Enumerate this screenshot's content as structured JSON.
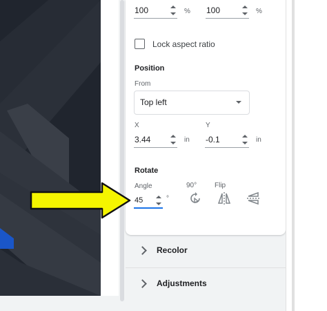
{
  "size": {
    "width": {
      "value": "100",
      "unit": "%"
    },
    "height": {
      "value": "100",
      "unit": "%"
    }
  },
  "lock_aspect_ratio": {
    "label": "Lock aspect ratio",
    "checked": false
  },
  "position": {
    "title": "Position",
    "from_label": "From",
    "from_value": "Top left",
    "x_label": "X",
    "x_value": "3.44",
    "x_unit": "in",
    "y_label": "Y",
    "y_value": "-0.1",
    "y_unit": "in"
  },
  "rotate": {
    "title": "Rotate",
    "angle_label": "Angle",
    "angle_value": "45",
    "angle_unit": "°",
    "rotate90_label": "90°",
    "flip_label": "Flip"
  },
  "sections": {
    "recolor": "Recolor",
    "adjustments": "Adjustments"
  },
  "colors": {
    "accent": "#1a73e8",
    "annotation_arrow": "#f5f500"
  },
  "icons": {
    "rotate90": "rotate-90-icon",
    "flip_horizontal": "flip-horizontal-icon",
    "flip_vertical": "flip-vertical-icon"
  }
}
